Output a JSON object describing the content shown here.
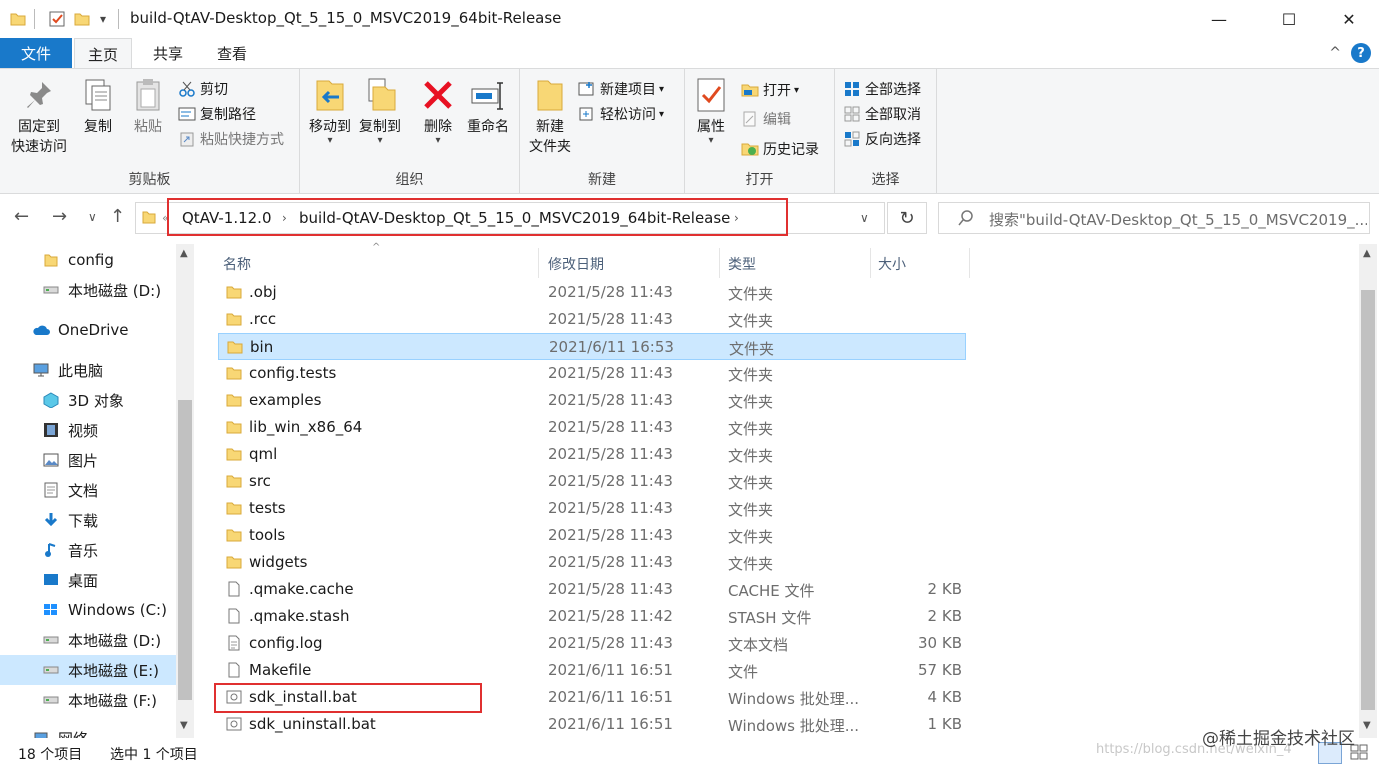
{
  "window": {
    "title": "build-QtAV-Desktop_Qt_5_15_0_MSVC2019_64bit-Release",
    "quick_access_dropdown": "▾",
    "minimize": "—",
    "maximize": "☐",
    "close": "✕"
  },
  "ribbon_tabs": {
    "file": "文件",
    "home": "主页",
    "share": "共享",
    "view": "查看",
    "collapse": "^",
    "help": "?"
  },
  "ribbon": {
    "clipboard": {
      "label": "剪贴板",
      "pin": [
        "固定到",
        "快速访问"
      ],
      "copy": "复制",
      "paste": "粘贴",
      "cut": "剪切",
      "copy_path": "复制路径",
      "paste_shortcut": "粘贴快捷方式"
    },
    "organize": {
      "label": "组织",
      "move_to": "移动到",
      "copy_to": "复制到",
      "delete": "删除",
      "rename": "重命名"
    },
    "new": {
      "label": "新建",
      "new_folder": [
        "新建",
        "文件夹"
      ],
      "new_item": "新建项目",
      "easy_access": "轻松访问"
    },
    "open": {
      "label": "打开",
      "properties": "属性",
      "open": "打开",
      "edit": "编辑",
      "history": "历史记录"
    },
    "select": {
      "label": "选择",
      "select_all": "全部选择",
      "select_none": "全部取消",
      "invert": "反向选择"
    }
  },
  "address": {
    "crumbs": [
      "QtAV-1.12.0",
      "build-QtAV-Desktop_Qt_5_15_0_MSVC2019_64bit-Release"
    ],
    "overflow": "«",
    "search_placeholder": "搜索\"build-QtAV-Desktop_Qt_5_15_0_MSVC2019_..."
  },
  "nav_pane": [
    {
      "label": "config",
      "icon": "folder-icon"
    },
    {
      "label": "本地磁盘 (D:)",
      "icon": "drive-icon"
    },
    {
      "label": "OneDrive",
      "icon": "cloud-icon"
    },
    {
      "label": "此电脑",
      "icon": "computer-icon"
    },
    {
      "label": "3D 对象",
      "icon": "cube-icon"
    },
    {
      "label": "视频",
      "icon": "video-icon"
    },
    {
      "label": "图片",
      "icon": "picture-icon"
    },
    {
      "label": "文档",
      "icon": "document-icon"
    },
    {
      "label": "下载",
      "icon": "download-icon"
    },
    {
      "label": "音乐",
      "icon": "music-icon"
    },
    {
      "label": "桌面",
      "icon": "desktop-icon"
    },
    {
      "label": "Windows (C:)",
      "icon": "windows-drive-icon"
    },
    {
      "label": "本地磁盘 (D:)",
      "icon": "drive-icon"
    },
    {
      "label": "本地磁盘 (E:)",
      "icon": "drive-icon"
    },
    {
      "label": "本地磁盘 (F:)",
      "icon": "drive-icon"
    },
    {
      "label": "网络",
      "icon": "network-icon"
    }
  ],
  "columns": {
    "name": "名称",
    "date": "修改日期",
    "type": "类型",
    "size": "大小"
  },
  "files": [
    {
      "name": ".obj",
      "date": "2021/5/28 11:43",
      "type": "文件夹",
      "size": "",
      "kind": "folder"
    },
    {
      "name": ".rcc",
      "date": "2021/5/28 11:43",
      "type": "文件夹",
      "size": "",
      "kind": "folder"
    },
    {
      "name": "bin",
      "date": "2021/6/11 16:53",
      "type": "文件夹",
      "size": "",
      "kind": "folder"
    },
    {
      "name": "config.tests",
      "date": "2021/5/28 11:43",
      "type": "文件夹",
      "size": "",
      "kind": "folder"
    },
    {
      "name": "examples",
      "date": "2021/5/28 11:43",
      "type": "文件夹",
      "size": "",
      "kind": "folder"
    },
    {
      "name": "lib_win_x86_64",
      "date": "2021/5/28 11:43",
      "type": "文件夹",
      "size": "",
      "kind": "folder"
    },
    {
      "name": "qml",
      "date": "2021/5/28 11:43",
      "type": "文件夹",
      "size": "",
      "kind": "folder"
    },
    {
      "name": "src",
      "date": "2021/5/28 11:43",
      "type": "文件夹",
      "size": "",
      "kind": "folder"
    },
    {
      "name": "tests",
      "date": "2021/5/28 11:43",
      "type": "文件夹",
      "size": "",
      "kind": "folder"
    },
    {
      "name": "tools",
      "date": "2021/5/28 11:43",
      "type": "文件夹",
      "size": "",
      "kind": "folder"
    },
    {
      "name": "widgets",
      "date": "2021/5/28 11:43",
      "type": "文件夹",
      "size": "",
      "kind": "folder"
    },
    {
      "name": ".qmake.cache",
      "date": "2021/5/28 11:43",
      "type": "CACHE 文件",
      "size": "2 KB",
      "kind": "file"
    },
    {
      "name": ".qmake.stash",
      "date": "2021/5/28 11:42",
      "type": "STASH 文件",
      "size": "2 KB",
      "kind": "file"
    },
    {
      "name": "config.log",
      "date": "2021/5/28 11:43",
      "type": "文本文档",
      "size": "30 KB",
      "kind": "text"
    },
    {
      "name": "Makefile",
      "date": "2021/6/11 16:51",
      "type": "文件",
      "size": "57 KB",
      "kind": "file"
    },
    {
      "name": "sdk_install.bat",
      "date": "2021/6/11 16:51",
      "type": "Windows 批处理...",
      "size": "4 KB",
      "kind": "bat"
    },
    {
      "name": "sdk_uninstall.bat",
      "date": "2021/6/11 16:51",
      "type": "Windows 批处理...",
      "size": "1 KB",
      "kind": "bat"
    }
  ],
  "status": {
    "count": "18 个项目",
    "selected": "选中 1 个项目"
  },
  "watermark": {
    "main": "@稀土掘金技术社区",
    "faint": "https://blog.csdn.net/weixin_4"
  },
  "colors": {
    "accent": "#1979ca",
    "selection": "#cce8ff",
    "highlight_box": "#e03030",
    "folder": "#f8d775"
  }
}
